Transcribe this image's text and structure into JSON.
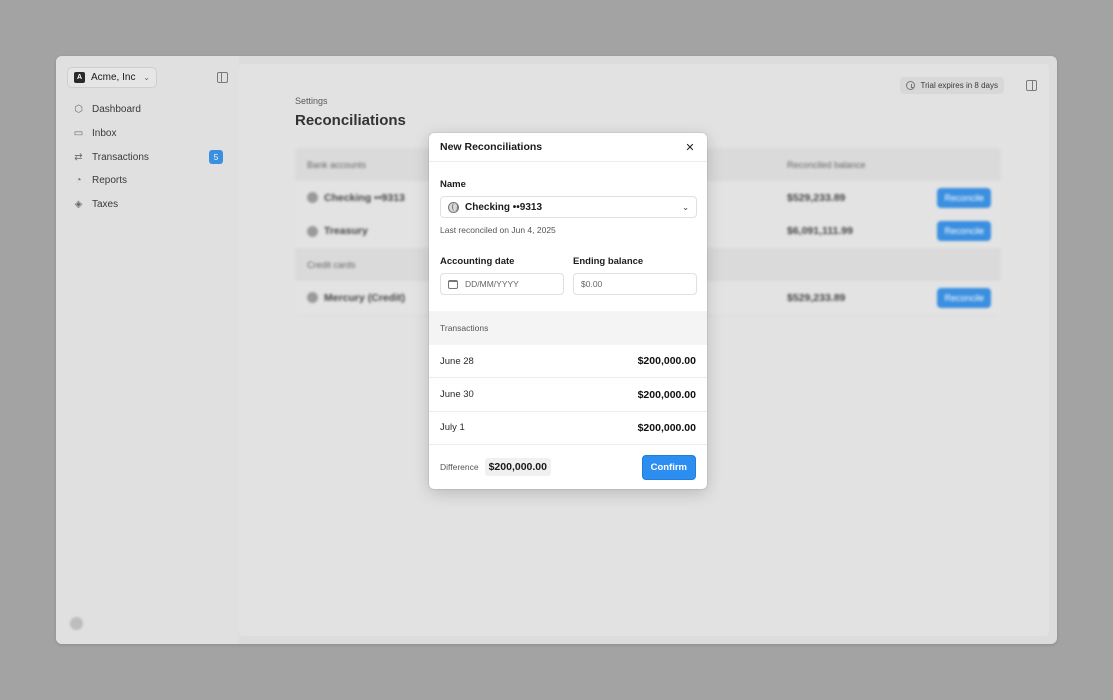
{
  "sidebar": {
    "org_name": "Acme, Inc",
    "org_logo": "A",
    "items": [
      {
        "label": "Dashboard",
        "icon": "cube-icon"
      },
      {
        "label": "Inbox",
        "icon": "inbox-icon"
      },
      {
        "label": "Transactions",
        "icon": "arrows-icon",
        "badge": "5"
      },
      {
        "label": "Reports",
        "icon": "pie-icon"
      },
      {
        "label": "Taxes",
        "icon": "layers-icon"
      }
    ]
  },
  "header": {
    "trial_text": "Trial expires in 8 days",
    "breadcrumb": "Settings",
    "title": "Reconciliations"
  },
  "table": {
    "bank_header": "Bank accounts",
    "balance_header": "Reconciled balance",
    "rows": [
      {
        "name": "Checking ••9313",
        "balance": "$529,233.89",
        "action": "Reconcile"
      },
      {
        "name": "Treasury",
        "balance": "$6,091,111.99",
        "action": "Reconcile"
      }
    ],
    "credit_header": "Credit cards",
    "credit_rows": [
      {
        "name": "Mercury (Credit)",
        "balance": "$529,233.89",
        "action": "Reconcile"
      }
    ]
  },
  "modal": {
    "title": "New Reconciliations",
    "name_label": "Name",
    "account_value": "Checking ••9313",
    "hint": "Last reconciled on Jun 4, 2025",
    "date_label": "Accounting date",
    "date_placeholder": "DD/MM/YYYY",
    "balance_label": "Ending balance",
    "balance_placeholder": "$0.00",
    "transactions_label": "Transactions",
    "transactions": [
      {
        "date": "June 28",
        "amount": "$200,000.00"
      },
      {
        "date": "June 30",
        "amount": "$200,000.00"
      },
      {
        "date": "July 1",
        "amount": "$200,000.00"
      }
    ],
    "difference_label": "Difference",
    "difference_value": "$200,000.00",
    "confirm_label": "Confirm"
  },
  "colors": {
    "accent": "#2b8ef0",
    "badge": "#3b8fe0"
  }
}
